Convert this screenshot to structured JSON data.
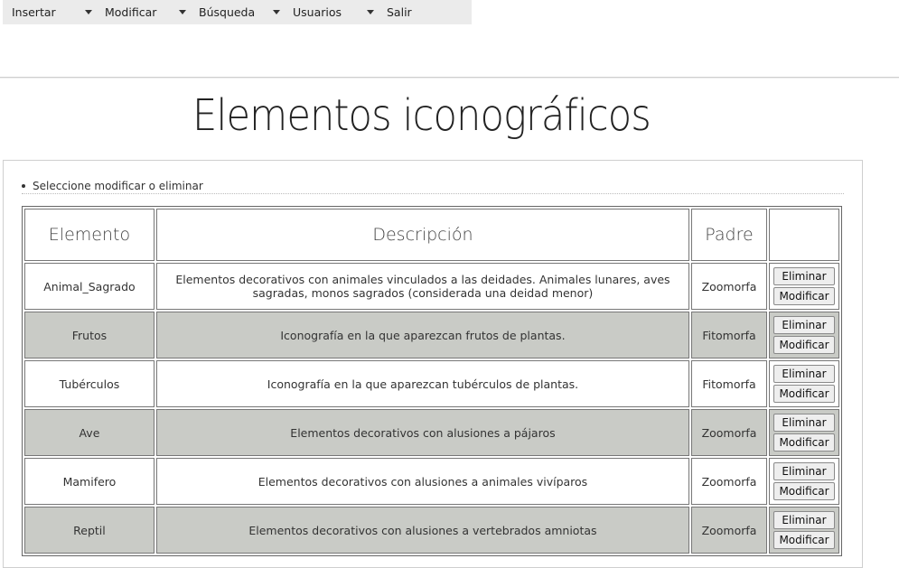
{
  "menu": {
    "items": [
      {
        "label": "Insertar",
        "has_dropdown": true
      },
      {
        "label": "Modificar",
        "has_dropdown": true
      },
      {
        "label": "Búsqueda",
        "has_dropdown": true
      },
      {
        "label": "Usuarios",
        "has_dropdown": true
      },
      {
        "label": "Salir",
        "has_dropdown": false
      }
    ]
  },
  "page": {
    "title": "Elementos iconográficos",
    "hint": "Seleccione modificar o eliminar"
  },
  "table": {
    "headers": [
      "Elemento",
      "Descripción",
      "Padre",
      ""
    ],
    "delete_label": "Eliminar",
    "modify_label": "Modificar",
    "rows": [
      {
        "elemento": "Animal_Sagrado",
        "descripcion": "Elementos decorativos con animales vinculados a las deidades. Animales lunares, aves sagradas, monos sagrados (considerada una deidad menor)",
        "padre": "Zoomorfa"
      },
      {
        "elemento": "Frutos",
        "descripcion": "Iconografía en la que aparezcan frutos de plantas.",
        "padre": "Fitomorfa"
      },
      {
        "elemento": "Tubérculos",
        "descripcion": "Iconografía en la que aparezcan tubérculos de plantas.",
        "padre": "Fitomorfa"
      },
      {
        "elemento": "Ave",
        "descripcion": "Elementos decorativos con alusiones a pájaros",
        "padre": "Zoomorfa"
      },
      {
        "elemento": "Mamifero",
        "descripcion": "Elementos decorativos con alusiones a animales vivíparos",
        "padre": "Zoomorfa"
      },
      {
        "elemento": "Reptil",
        "descripcion": "Elementos decorativos con alusiones a vertebrados amniotas",
        "padre": "Zoomorfa"
      }
    ]
  },
  "colors": {
    "menu_bg": "#ebebeb",
    "alt_row": "#c9cbc6"
  }
}
